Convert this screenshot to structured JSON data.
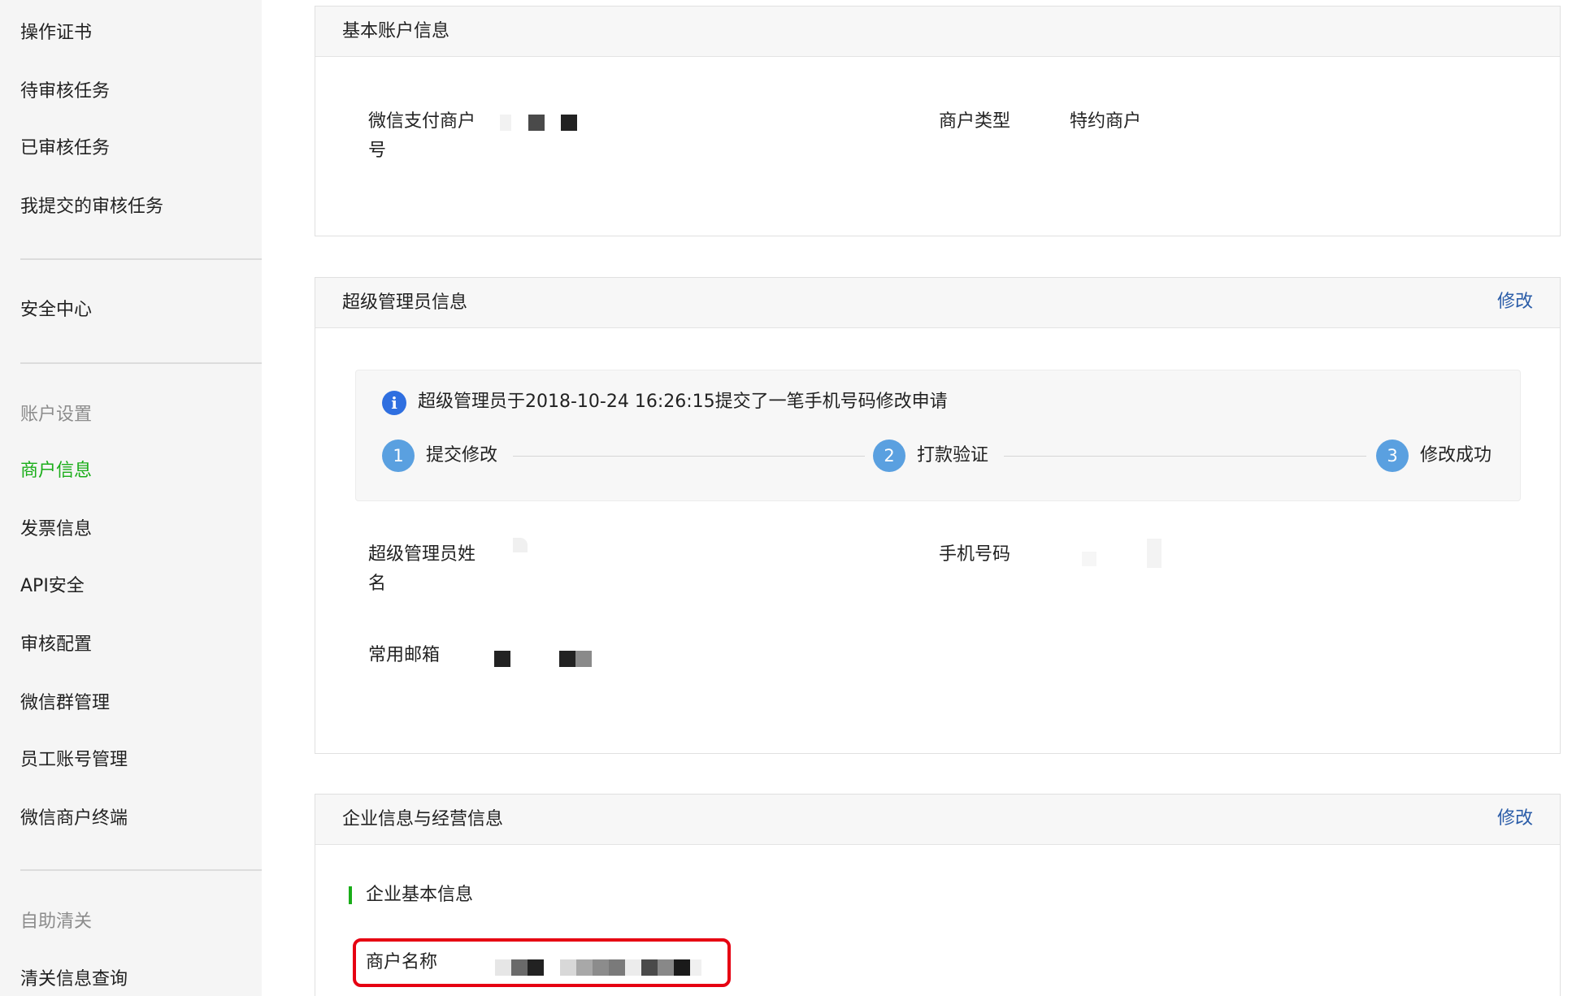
{
  "sidebar": {
    "items": [
      {
        "label": "操作证书"
      },
      {
        "label": "待审核任务"
      },
      {
        "label": "已审核任务"
      },
      {
        "label": "我提交的审核任务"
      },
      {
        "label": "安全中心"
      },
      {
        "label": "账户设置"
      },
      {
        "label": "商户信息"
      },
      {
        "label": "发票信息"
      },
      {
        "label": "API安全"
      },
      {
        "label": "审核配置"
      },
      {
        "label": "微信群管理"
      },
      {
        "label": "员工账号管理"
      },
      {
        "label": "微信商户终端"
      },
      {
        "label": "自助清关"
      },
      {
        "label": "清关信息查询"
      }
    ],
    "active_item": "商户信息",
    "active_color": "#1aad19"
  },
  "basic_account": {
    "title": "基本账户信息",
    "merchant_id_label": "微信支付商户号",
    "merchant_type_label": "商户类型",
    "merchant_type_value": "特约商户"
  },
  "super_admin": {
    "title": "超级管理员信息",
    "edit_label": "修改",
    "notice": {
      "icon": "info-icon",
      "text": "超级管理员于2018-10-24 16:26:15提交了一笔手机号码修改申请"
    },
    "steps": [
      {
        "number": "1",
        "label": "提交修改"
      },
      {
        "number": "2",
        "label": "打款验证"
      },
      {
        "number": "3",
        "label": "修改成功"
      }
    ],
    "name_label": "超级管理员姓名",
    "phone_label": "手机号码",
    "email_label": "常用邮箱"
  },
  "enterprise": {
    "title": "企业信息与经营信息",
    "edit_label": "修改",
    "subsection_title": "企业基本信息",
    "merchant_name_label": "商户名称"
  },
  "colors": {
    "link": "#2a5ca8",
    "highlight_border": "#e60012",
    "step": "#5aa0e0"
  }
}
